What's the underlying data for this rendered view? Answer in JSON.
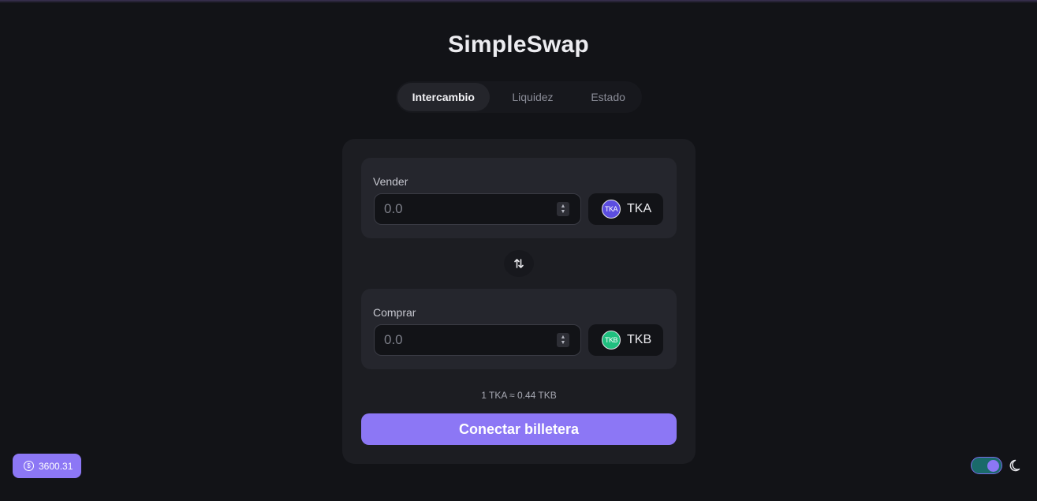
{
  "app": {
    "title": "SimpleSwap"
  },
  "tabs": [
    {
      "label": "Intercambio",
      "active": true
    },
    {
      "label": "Liquidez",
      "active": false
    },
    {
      "label": "Estado",
      "active": false
    }
  ],
  "swap": {
    "sell": {
      "label": "Vender",
      "value": "",
      "placeholder": "0.0",
      "token": {
        "symbol": "TKA",
        "logo_text": "TKA",
        "color": "#5b4de0"
      }
    },
    "buy": {
      "label": "Comprar",
      "value": "",
      "placeholder": "0.0",
      "token": {
        "symbol": "TKB",
        "logo_text": "TKB",
        "color": "#1fbf7f"
      }
    },
    "switch_icon": "swap-vertical-arrows-icon",
    "rate": "1 TKA ≈ 0.44 TKB",
    "connect_label": "Conectar billetera"
  },
  "footer": {
    "balance": "3600.31",
    "balance_icon": "dollar-coin-icon",
    "theme": {
      "dark_mode": true,
      "icon": "moon-icon"
    }
  },
  "colors": {
    "background": "#121317",
    "card": "#1c1d22",
    "panel": "#25262d",
    "accent": "#8c77f5"
  }
}
